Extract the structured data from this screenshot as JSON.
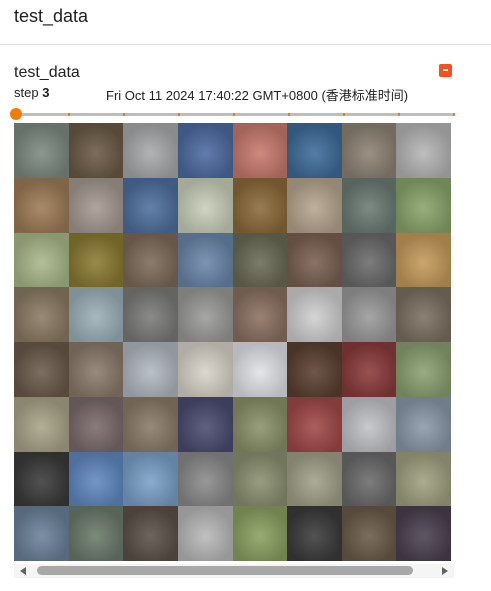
{
  "header": {
    "title": "test_data"
  },
  "card": {
    "title": "test_data",
    "step_label": "step",
    "step_value": "3",
    "timestamp": "Fri Oct 11 2024 17:40:22 GMT+0800 (香港标准时间)"
  },
  "colors": {
    "accent": "#f57c00",
    "expand_button": "#f4511e",
    "track": "#bdbdbd"
  },
  "slider": {
    "ticks": 9,
    "position": 0
  },
  "images": [
    [
      "#7c8a80",
      "#6b5a45",
      "#a7a9aa",
      "#4c6aa0",
      "#c8796d",
      "#3d6b9a",
      "#8c8273",
      "#b5b5b5"
    ],
    [
      "#9c7b55",
      "#a49990",
      "#4d6f9d",
      "#c9ceb9",
      "#8a6a3a",
      "#b5a58d",
      "#6b7a73",
      "#8aa46a"
    ],
    [
      "#a8b88a",
      "#8a7a30",
      "#7c6a58",
      "#6a86a8",
      "#6a6a55",
      "#7a6050",
      "#6a6a6a",
      "#c49a5a"
    ],
    [
      "#8a7a62",
      "#9cb0b8",
      "#7a7a78",
      "#9a9a98",
      "#8a7060",
      "#cfcfcf",
      "#9a9a9a",
      "#7a7060"
    ],
    [
      "#6a5a4a",
      "#8a7a6a",
      "#b0b8c0",
      "#d8d2c8",
      "#e0e2e6",
      "#5a4030",
      "#8a3a3a",
      "#8aa070"
    ],
    [
      "#a8a488",
      "#7a6a6a",
      "#8a7a68",
      "#4a4a70",
      "#8a9068",
      "#a04848",
      "#c0c2c6",
      "#8a98a8"
    ],
    [
      "#3a3a3a",
      "#6088c0",
      "#7aa0c8",
      "#8a8a8a",
      "#8a9070",
      "#a0a088",
      "#6a6a6a",
      "#a0a080"
    ],
    [
      "#6a8098",
      "#6a7a6a",
      "#5a5048",
      "#b8b8b8",
      "#8aa060",
      "#3a3a3a",
      "#6a5a48",
      "#4a4050"
    ]
  ]
}
